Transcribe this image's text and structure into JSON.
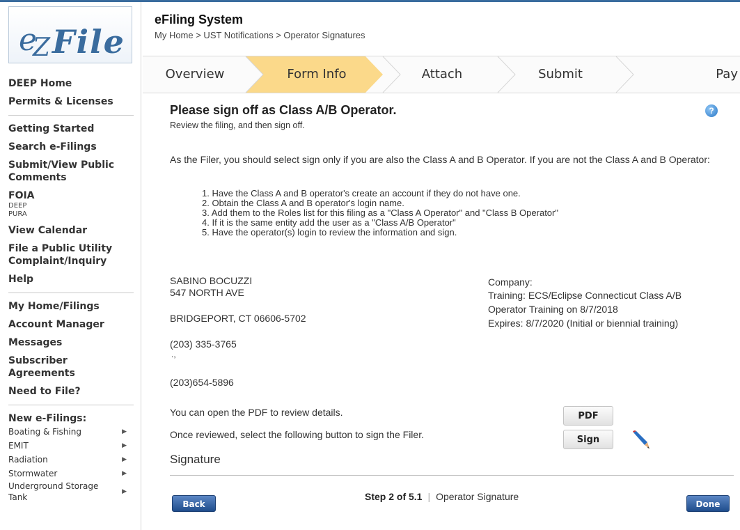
{
  "logo": {
    "text": "eZFile"
  },
  "header": {
    "title": "eFiling System",
    "breadcrumb": "My Home > UST Notifications > Operator Signatures"
  },
  "sidebar": {
    "group1": [
      "DEEP Home",
      "Permits & Licenses"
    ],
    "group2": [
      "Getting Started",
      "Search e-Filings",
      "Submit/View Public Comments"
    ],
    "foia": {
      "label": "FOIA",
      "subs": [
        "DEEP",
        "PURA"
      ]
    },
    "group3": [
      "View Calendar",
      "File a Public Utility Complaint/Inquiry",
      "Help"
    ],
    "group4": [
      "My Home/Filings",
      "Account Manager",
      "Messages",
      "Subscriber Agreements",
      "Need to File?"
    ],
    "new_title": "New e-Filings:",
    "new_items": [
      "Boating & Fishing",
      "EMIT",
      "Radiation",
      "Stormwater",
      "Underground Storage Tank"
    ]
  },
  "wizard": {
    "steps": [
      "Overview",
      "Form Info",
      "Attach",
      "Submit",
      "Pay"
    ],
    "active": "Form Info"
  },
  "main": {
    "heading": "Please sign off as Class A/B Operator.",
    "subheading": "Review the filing, and then sign off.",
    "intro": "As the Filer, you should select sign only if you are also the Class A and B Operator. If you are not the Class A and B Operator:",
    "steps": [
      "1. Have the Class A and B operator's create an account if they do not have one.",
      "2. Obtain the Class A and B operator's login name.",
      "3. Add them to the Roles list for this filing as a \"Class A Operator\" and \"Class B Operator\"",
      "4. If it is the same entity add the user as a \"Class A/B Operator\"",
      "5. Have the operator(s) login to review the information and sign."
    ],
    "operator": {
      "name": "SABINO BOCUZZI",
      "street": "547 NORTH AVE",
      "city": "BRIDGEPORT, CT 06606-5702",
      "phone1": "(203) 335-3765",
      "separator": ".,",
      "phone2": "(203)654-5896"
    },
    "company": {
      "label": "Company:",
      "training": "Training: ECS/Eclipse Connecticut Class A/B",
      "training2": "Operator Training on 8/7/2018",
      "expires": "Expires: 8/7/2020 (Initial or biennial training)"
    },
    "pdf_text": "You can open the PDF to review details.",
    "pdf_button": "PDF",
    "sign_text": "Once reviewed, select the following button to sign the Filer.",
    "sign_button": "Sign",
    "signature_label": "Signature"
  },
  "footer": {
    "back": "Back",
    "step": "Step 2 of 5.1",
    "step_name": "Operator Signature",
    "done": "Done"
  },
  "help_icon": "?"
}
